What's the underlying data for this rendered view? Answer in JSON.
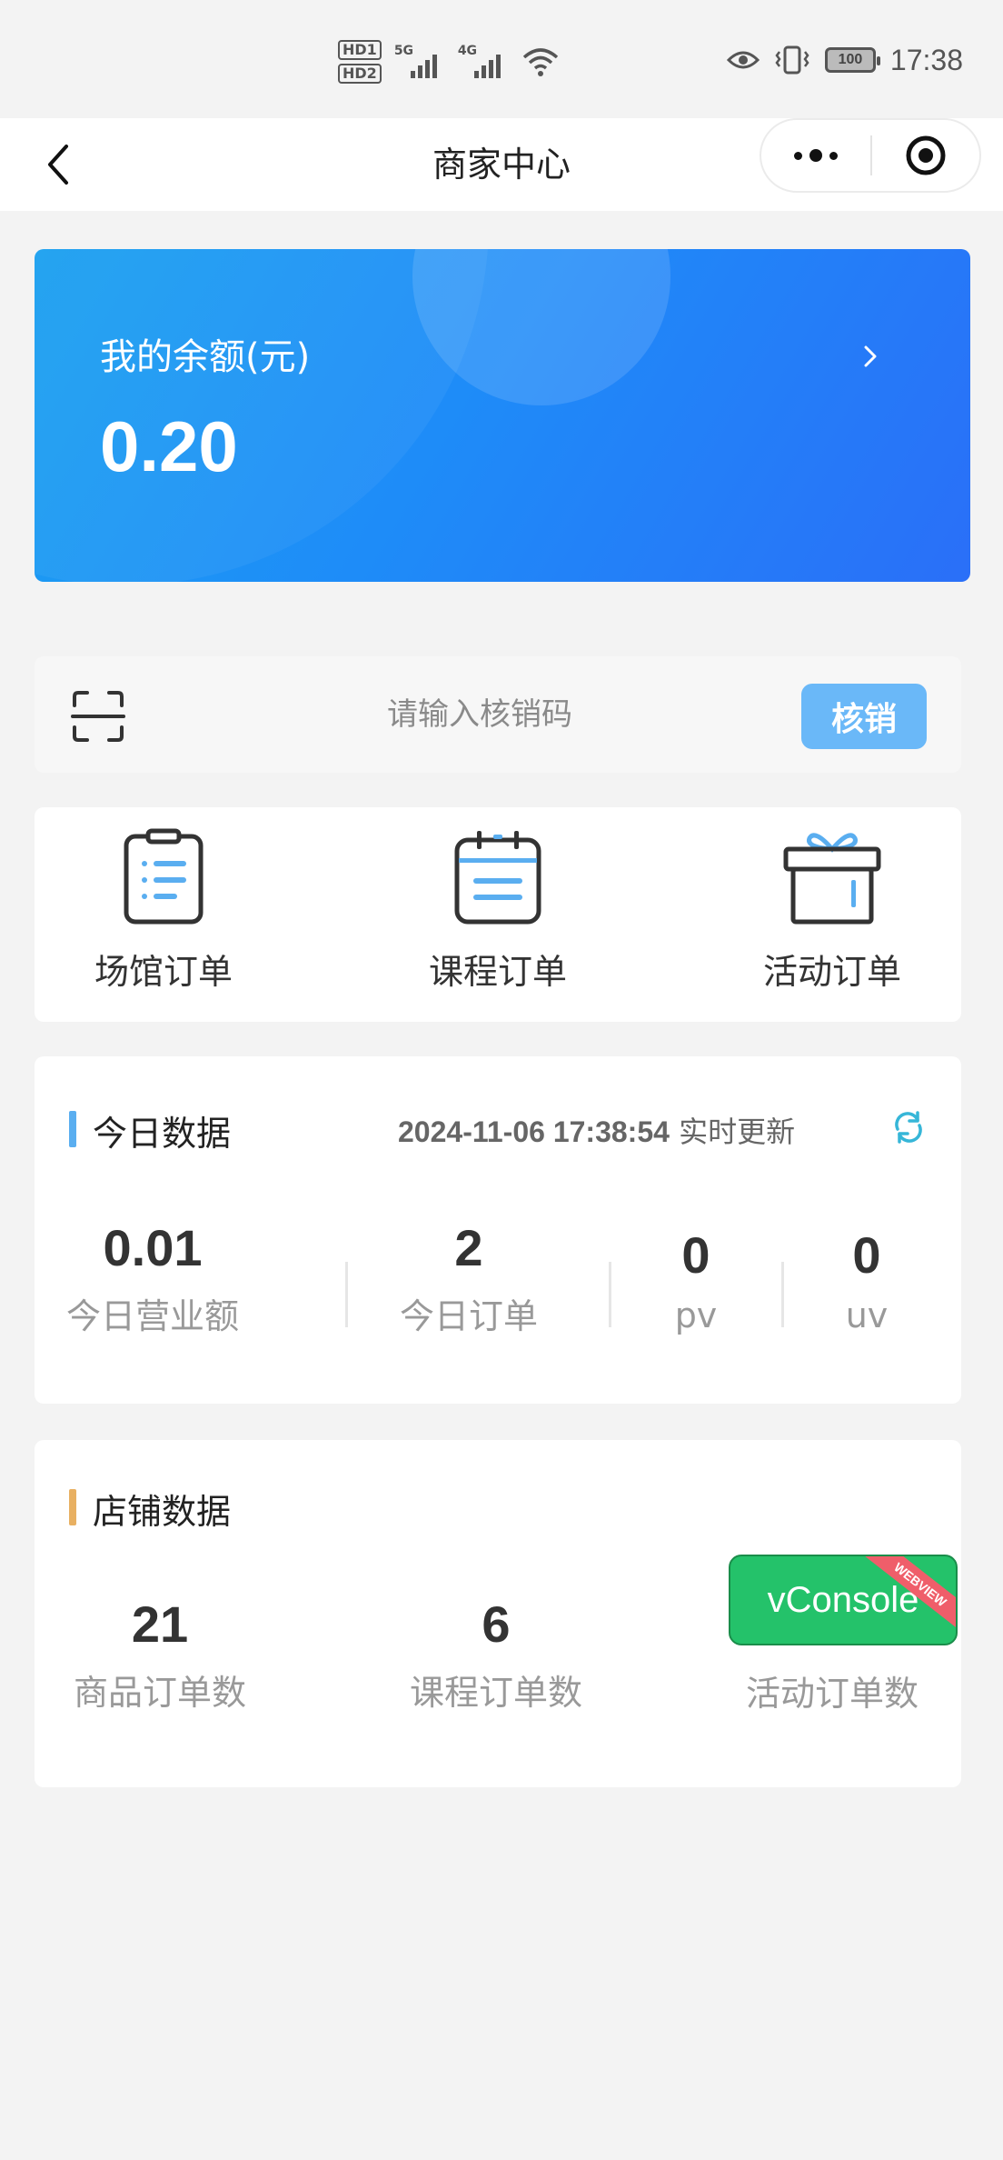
{
  "status_bar": {
    "hd1": "HD1",
    "hd2": "HD2",
    "net1": "5G",
    "net2": "4G",
    "battery": "100",
    "time": "17:38"
  },
  "nav": {
    "title": "商家中心"
  },
  "balance": {
    "label": "我的余额(元)",
    "value": "0.20"
  },
  "verify": {
    "placeholder": "请输入核销码",
    "button": "核销"
  },
  "orders": [
    {
      "label": "场馆订单",
      "icon": "clipboard-list-icon"
    },
    {
      "label": "课程订单",
      "icon": "calendar-list-icon"
    },
    {
      "label": "活动订单",
      "icon": "gift-box-icon"
    }
  ],
  "today": {
    "title": "今日数据",
    "timestamp": "2024-11-06 17:38:54",
    "update_text": "实时更新",
    "stats": [
      {
        "value": "0.01",
        "label": "今日营业额"
      },
      {
        "value": "2",
        "label": "今日订单"
      },
      {
        "value": "0",
        "label": "pv"
      },
      {
        "value": "0",
        "label": "uv"
      }
    ]
  },
  "shop": {
    "title": "店铺数据",
    "stats": [
      {
        "value": "21",
        "label": "商品订单数"
      },
      {
        "value": "6",
        "label": "课程订单数"
      },
      {
        "value": "",
        "label": "活动订单数"
      }
    ]
  },
  "vconsole": {
    "label": "vConsole",
    "ribbon": "WEBVIEW"
  },
  "colors": {
    "balance_gradient_start": "#1aa0f0",
    "balance_gradient_end": "#2a6ff8",
    "verify_button": "#6ab8f8",
    "today_accent": "#5aaef0",
    "shop_accent": "#e8b062",
    "vconsole_green": "#24c26a"
  }
}
